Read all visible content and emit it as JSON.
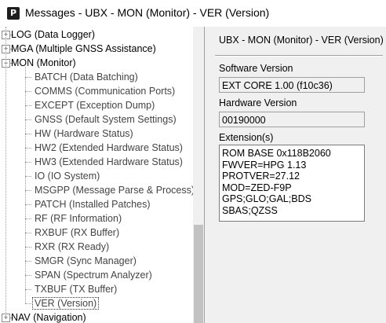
{
  "window": {
    "title": "Messages - UBX - MON (Monitor) - VER (Version)"
  },
  "tree": {
    "items": [
      {
        "label": "LOG (Data Logger)",
        "level": 0,
        "expander": "+"
      },
      {
        "label": "MGA (Multiple GNSS Assistance)",
        "level": 0,
        "expander": "+"
      },
      {
        "label": "MON (Monitor)",
        "level": 0,
        "expander": "−"
      },
      {
        "label": "BATCH (Data Batching)",
        "level": 1
      },
      {
        "label": "COMMS (Communication Ports)",
        "level": 1
      },
      {
        "label": "EXCEPT (Exception Dump)",
        "level": 1
      },
      {
        "label": "GNSS (Default System Settings)",
        "level": 1
      },
      {
        "label": "HW (Hardware Status)",
        "level": 1
      },
      {
        "label": "HW2 (Extended Hardware Status)",
        "level": 1
      },
      {
        "label": "HW3 (Extended Hardware Status)",
        "level": 1
      },
      {
        "label": "IO (IO System)",
        "level": 1
      },
      {
        "label": "MSGPP (Message Parse & Process)",
        "level": 1
      },
      {
        "label": "PATCH (Installed Patches)",
        "level": 1
      },
      {
        "label": "RF (RF Information)",
        "level": 1
      },
      {
        "label": "RXBUF (RX Buffer)",
        "level": 1
      },
      {
        "label": "RXR (RX Ready)",
        "level": 1
      },
      {
        "label": "SMGR (Sync Manager)",
        "level": 1
      },
      {
        "label": "SPAN (Spectrum Analyzer)",
        "level": 1
      },
      {
        "label": "TXBUF (TX Buffer)",
        "level": 1
      },
      {
        "label": "VER (Version)",
        "level": 1,
        "selected": true
      },
      {
        "label": "NAV (Navigation)",
        "level": 0,
        "expander": "+"
      }
    ]
  },
  "panel": {
    "title": "UBX - MON (Monitor) - VER (Version)",
    "software_version_label": "Software Version",
    "software_version_value": "EXT CORE 1.00 (f10c36)",
    "hardware_version_label": "Hardware Version",
    "hardware_version_value": "00190000",
    "extensions_label": "Extension(s)",
    "extensions": [
      "ROM BASE 0x118B2060",
      "FWVER=HPG 1.13",
      "PROTVER=27.12",
      "MOD=ZED-F9P",
      "GPS;GLO;GAL;BDS",
      "SBAS;QZSS"
    ]
  }
}
